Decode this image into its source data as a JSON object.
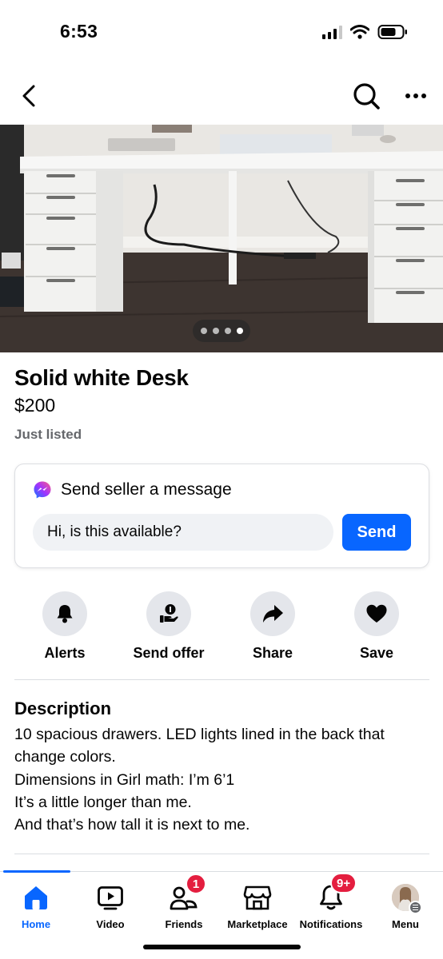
{
  "status_bar": {
    "time": "6:53",
    "icons": [
      "cellular-signal-icon",
      "wifi-icon",
      "battery-icon"
    ]
  },
  "top_nav": {
    "icons": [
      "back-chevron-icon",
      "search-icon",
      "more-options-icon"
    ]
  },
  "photo": {
    "image_count": 4,
    "active_index": 3
  },
  "listing": {
    "title": "Solid white Desk",
    "price": "$200",
    "listed": "Just listed"
  },
  "message_card": {
    "title": "Send seller a message",
    "input_value": "Hi, is this available?",
    "send_label": "Send"
  },
  "actions": [
    {
      "label": "Alerts",
      "icon": "bell-icon"
    },
    {
      "label": "Send offer",
      "icon": "offer-hand-icon"
    },
    {
      "label": "Share",
      "icon": "share-arrow-icon"
    },
    {
      "label": "Save",
      "icon": "heart-icon"
    }
  ],
  "description": {
    "heading": "Description",
    "lines": [
      "10 spacious drawers. LED lights lined in the back that",
      "change colors.",
      "Dimensions in Girl math: I’m 6’1",
      "It’s a little longer than me.",
      "And that’s how tall it is next to me."
    ]
  },
  "bottom_nav": {
    "items": [
      {
        "label": "Home",
        "icon": "home-icon",
        "active": true
      },
      {
        "label": "Video",
        "icon": "video-icon"
      },
      {
        "label": "Friends",
        "icon": "friends-icon",
        "badge": "1"
      },
      {
        "label": "Marketplace",
        "icon": "marketplace-icon"
      },
      {
        "label": "Notifications",
        "icon": "bell-icon",
        "badge": "9+"
      },
      {
        "label": "Menu",
        "icon": "avatar-icon"
      }
    ]
  },
  "colors": {
    "accent": "#0866ff",
    "badge": "#e41e3f",
    "secondary_text": "#65676b",
    "button_bg": "#e4e6eb"
  }
}
